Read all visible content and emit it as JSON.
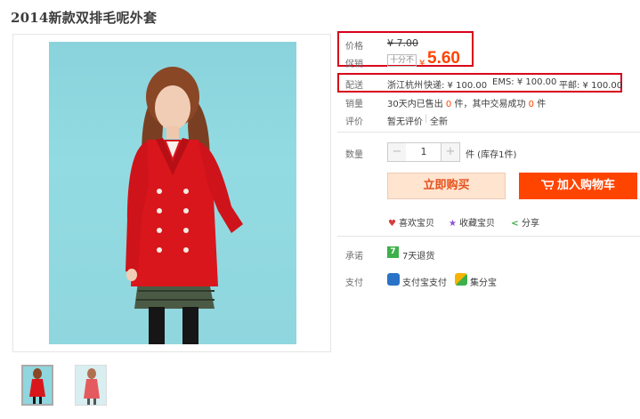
{
  "product": {
    "title": "2014新款双排毛呢外套"
  },
  "price": {
    "label": "价格",
    "original": "¥ 7.00",
    "promo_label": "促销",
    "promo_tag": "十分不",
    "currency": "¥",
    "promo_price": "5.60",
    "accent_color": "#ff4400"
  },
  "shipping": {
    "label": "配送",
    "location": "浙江杭州",
    "express": "快递: ¥ 100.00",
    "ems": "EMS: ¥ 100.00",
    "surface": "平邮: ¥ 100.00"
  },
  "sales": {
    "label": "销量",
    "prefix": "30天内已售出",
    "count": "0",
    "mid": "件，其中交易成功",
    "success": "0",
    "suffix": "件"
  },
  "review": {
    "label": "评价",
    "none": "暂无评价",
    "sep": "|",
    "all": "全新"
  },
  "quantity": {
    "label": "数量",
    "minus": "−",
    "value": "1",
    "plus": "+",
    "unit": "件 (库存1件)"
  },
  "buttons": {
    "buy_now": "立即购买",
    "add_cart": "加入购物车"
  },
  "actions": {
    "like": "喜欢宝贝",
    "favorite": "收藏宝贝",
    "share": "分享"
  },
  "promise": {
    "label": "承诺",
    "badge": "7",
    "text": "7天退货"
  },
  "payment": {
    "label": "支付",
    "alipay": "支付宝支付",
    "jifenbao": "集分宝"
  },
  "icons": [
    "heart-icon",
    "star-icon",
    "share-icon",
    "cart-icon",
    "alipay-icon",
    "jifenbao-icon"
  ]
}
